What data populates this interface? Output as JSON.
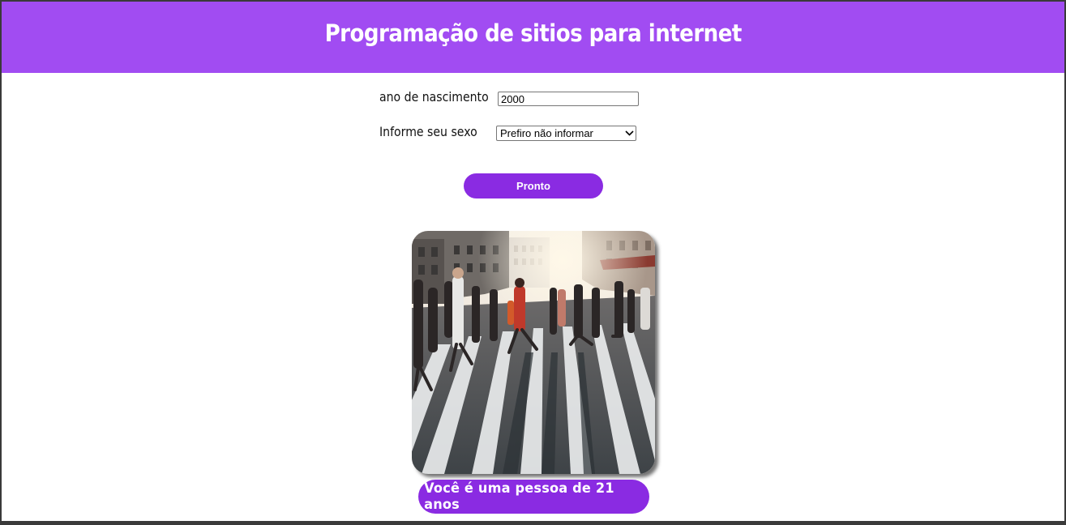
{
  "header": {
    "title": "Programação de sitios para internet"
  },
  "form": {
    "birth_year_label": "ano de nascimento",
    "birth_year_value": "2000",
    "sex_label": "Informe seu sexo",
    "sex_selected": "Prefiro não informar",
    "submit_label": "Pronto"
  },
  "result": {
    "message": "Você é uma pessoa de 21 anos"
  },
  "colors": {
    "header_bg": "#a14cf2",
    "accent": "#8a2be2"
  },
  "icons": {
    "select_arrow": "chevron-down-icon"
  }
}
